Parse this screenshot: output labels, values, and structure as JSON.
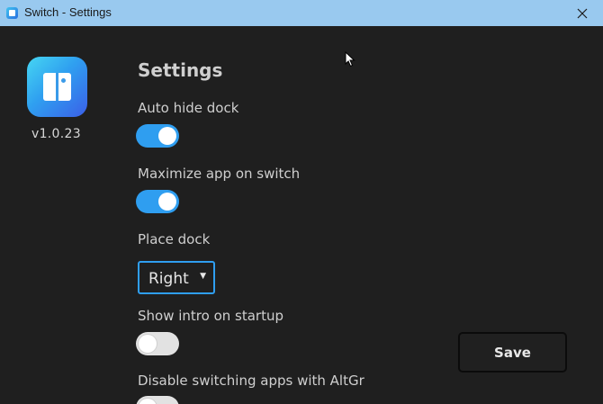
{
  "window": {
    "title": "Switch - Settings"
  },
  "app": {
    "version": "v1.0.23"
  },
  "settings": {
    "heading": "Settings",
    "auto_hide_dock": {
      "label": "Auto hide dock",
      "enabled": true
    },
    "maximize_app": {
      "label": "Maximize app on switch",
      "enabled": true
    },
    "place_dock": {
      "label": "Place dock",
      "selected": "Right"
    },
    "show_intro": {
      "label": "Show intro on startup",
      "enabled": false
    },
    "disable_altgr": {
      "label": "Disable switching apps with AltGr",
      "enabled": false
    }
  },
  "actions": {
    "save_label": "Save"
  },
  "colors": {
    "accent": "#2f9ef0",
    "titlebar": "#99c9ef",
    "background": "#1f1f1f"
  }
}
